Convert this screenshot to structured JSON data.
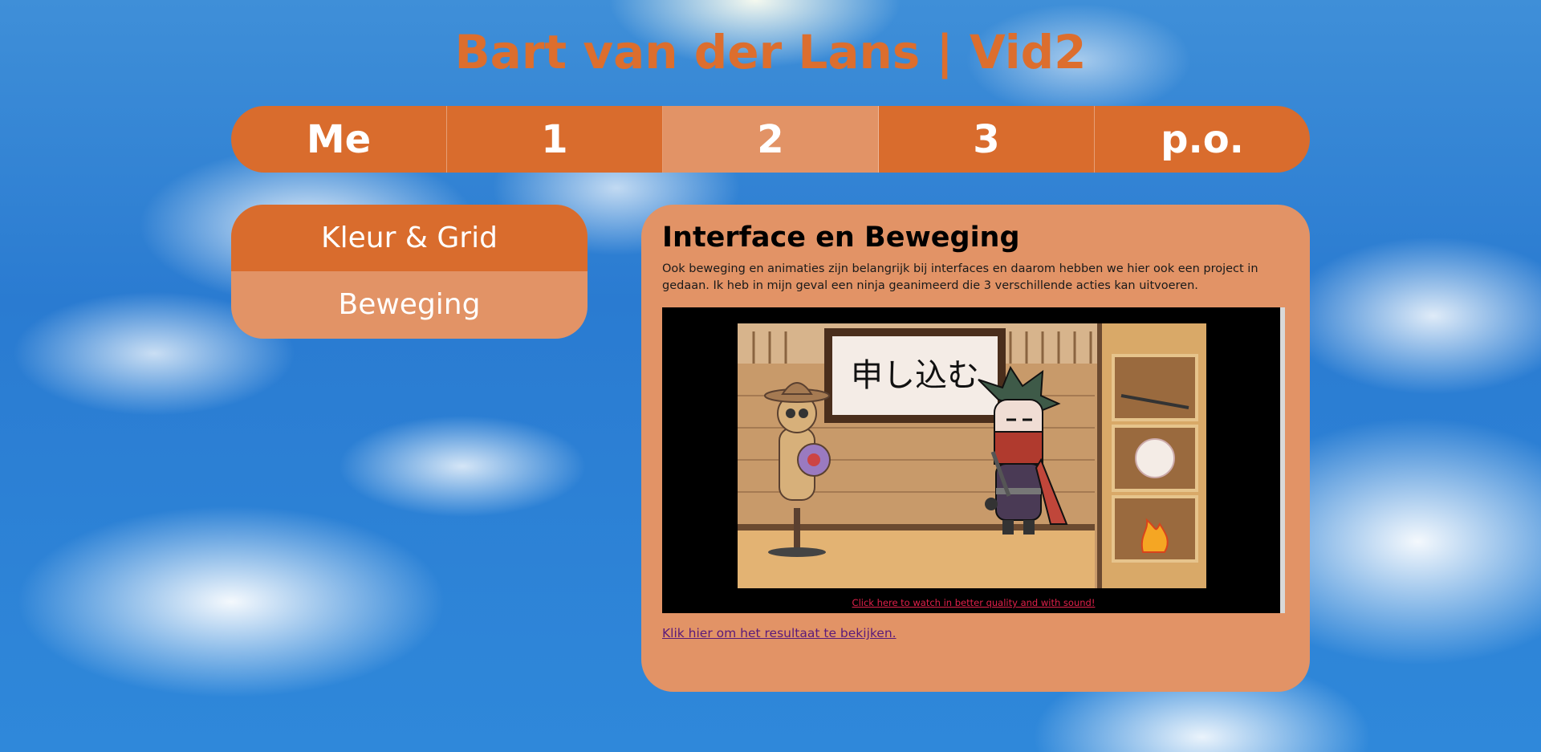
{
  "site": {
    "title": "Bart van der Lans | Vid2"
  },
  "nav": {
    "items": [
      {
        "label": "Me"
      },
      {
        "label": "1"
      },
      {
        "label": "2",
        "active": true
      },
      {
        "label": "3"
      },
      {
        "label": "p.o."
      }
    ]
  },
  "subnav": {
    "items": [
      {
        "label": "Kleur & Grid"
      },
      {
        "label": "Beweging",
        "active": true
      }
    ]
  },
  "content": {
    "heading": "Interface en Beweging",
    "body": "Ook beweging en animaties zijn belangrijk bij interfaces en daarom hebben we hier ook een project in gedaan. Ik heb in mijn geval een ninja geanimeerd die 3 verschillende acties kan uitvoeren.",
    "video": {
      "sign_text": "申し込む",
      "link_text": "Click here to watch in better quality and with sound!"
    },
    "result_link": "Klik hier om het resultaat te bekijken."
  },
  "colors": {
    "accent": "#d96c2d",
    "accent_light": "#e29366",
    "title": "#dc6e2e",
    "sky": "#2a7bd1"
  }
}
